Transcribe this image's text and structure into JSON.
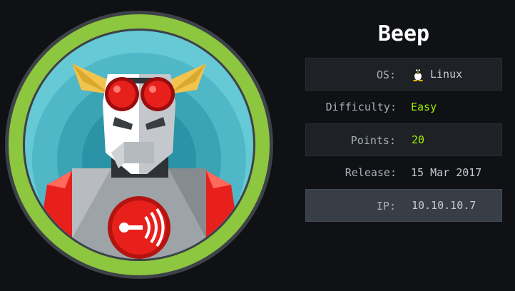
{
  "machine": {
    "name": "Beep"
  },
  "info": {
    "os_label": "OS:",
    "os_value": "Linux",
    "os_icon": "tux-icon",
    "difficulty_label": "Difficulty:",
    "difficulty_value": "Easy",
    "points_label": "Points:",
    "points_value": "20",
    "release_label": "Release:",
    "release_value": "15 Mar 2017",
    "ip_label": "IP:",
    "ip_value": "10.10.10.7"
  },
  "colors": {
    "background": "#0f1114",
    "accent_green": "#9fef00",
    "badge_ring": "#8dc63f",
    "badge_sky": "#5ec3d1",
    "robot_red": "#e8201c"
  }
}
